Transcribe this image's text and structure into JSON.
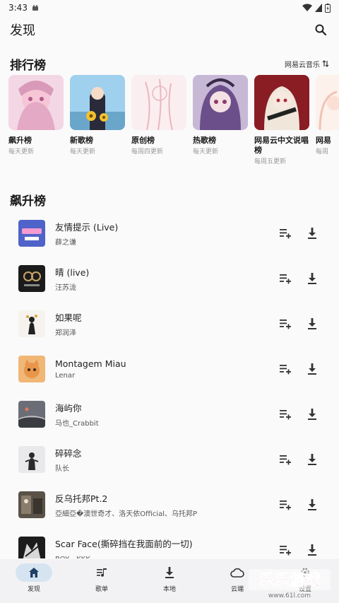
{
  "status": {
    "time": "3:43"
  },
  "header": {
    "title": "发现"
  },
  "charts_section": {
    "title": "排行榜",
    "source_label": "网易云音乐"
  },
  "rank_lists": [
    {
      "name": "飙升榜",
      "sub": "每天更新"
    },
    {
      "name": "新歌榜",
      "sub": "每天更新"
    },
    {
      "name": "原创榜",
      "sub": "每周四更新"
    },
    {
      "name": "热歌榜",
      "sub": "每天更新"
    },
    {
      "name": "网易云中文说唱榜",
      "sub": "每周五更新"
    },
    {
      "name": "网易",
      "sub": "每周"
    }
  ],
  "song_list": {
    "title": "飙升榜",
    "songs": [
      {
        "title": "友情提示 (Live)",
        "artist": "薛之谦"
      },
      {
        "title": "晴 (live)",
        "artist": "汪苏泷"
      },
      {
        "title": "如果呢",
        "artist": "郑润泽"
      },
      {
        "title": "Montagem Miau",
        "artist": "Lenar"
      },
      {
        "title": "海屿你",
        "artist": "马也_Crabbit"
      },
      {
        "title": "碎碎念",
        "artist": "队长"
      },
      {
        "title": "反乌托邦Pt.2",
        "artist": "亞細亞�澳世奇才、洛天依Official、乌托邦P"
      },
      {
        "title": "Scar Face(撕碎挡在我面前的一切)",
        "artist": "BOY、KKK"
      }
    ]
  },
  "nav": [
    {
      "label": "发现",
      "icon": "home-icon",
      "active": true
    },
    {
      "label": "歌单",
      "icon": "playlist-icon",
      "active": false
    },
    {
      "label": "本地",
      "icon": "download-icon",
      "active": false
    },
    {
      "label": "云端",
      "icon": "cloud-icon",
      "active": false
    },
    {
      "label": "设置",
      "icon": "settings-icon",
      "active": false
    }
  ],
  "watermark": {
    "text": "乐乐游戏",
    "url": "www.61l.com"
  },
  "colors": {
    "accent": "#d6e4f2",
    "nav_bg": "#f2f2f4",
    "subtext": "#9a9a9a"
  }
}
